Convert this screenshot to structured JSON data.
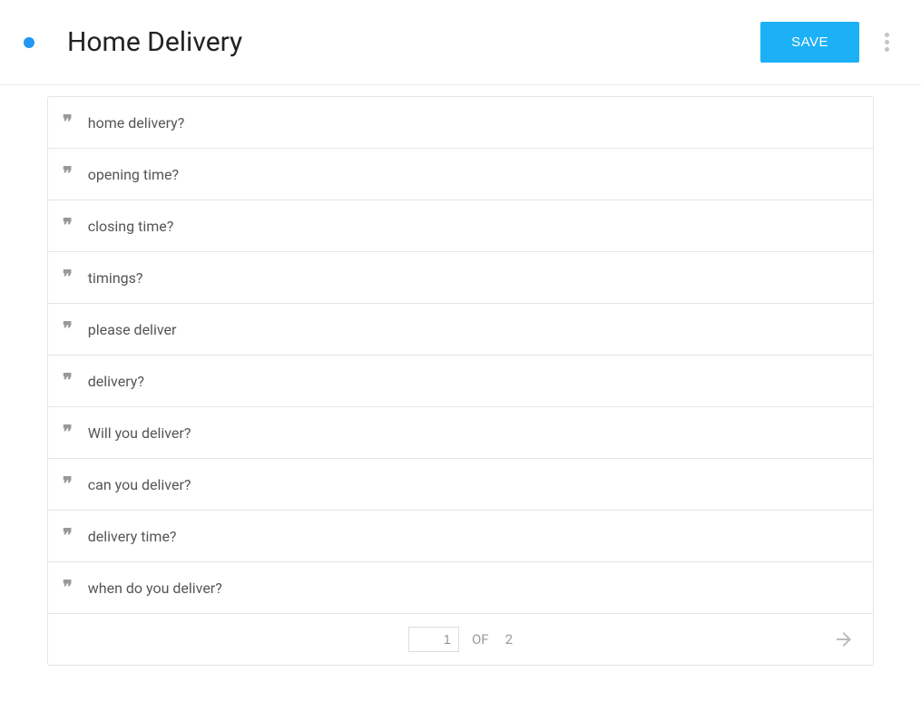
{
  "header": {
    "title": "Home Delivery",
    "save_label": "SAVE"
  },
  "items": [
    {
      "text": "home delivery?"
    },
    {
      "text": "opening time?"
    },
    {
      "text": "closing time?"
    },
    {
      "text": "timings?"
    },
    {
      "text": "please deliver"
    },
    {
      "text": "delivery?"
    },
    {
      "text": "Will you deliver?"
    },
    {
      "text": "can you deliver?"
    },
    {
      "text": "delivery time?"
    },
    {
      "text": "when do you deliver?"
    }
  ],
  "pagination": {
    "current": "1",
    "of_label": "OF",
    "total": "2"
  }
}
